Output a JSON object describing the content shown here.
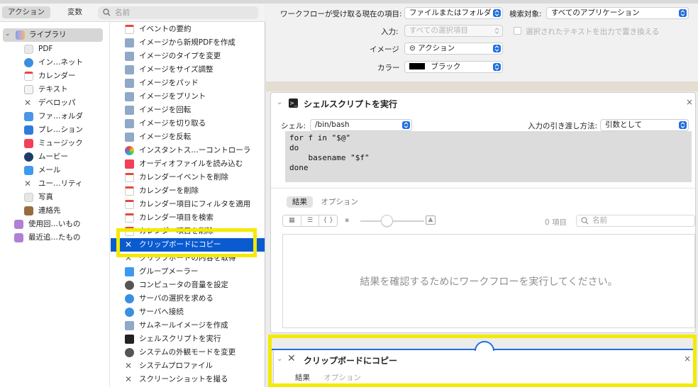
{
  "toolbar": {
    "actions_tab": "アクション",
    "variables_tab": "変数",
    "search_placeholder": "名前"
  },
  "library": {
    "root": "ライブラリ",
    "items": [
      "PDF",
      "イン…ネット",
      "カレンダー",
      "テキスト",
      "デベロッパ",
      "ファ…ォルダ",
      "プレ…ション",
      "ミュージック",
      "ムービー",
      "メール",
      "ユー…リティ",
      "写真",
      "連絡先"
    ],
    "smart": [
      "使用回…いもの",
      "最近追…たもの"
    ]
  },
  "actions": [
    "イベントの要約",
    "イメージから新規PDFを作成",
    "イメージのタイプを変更",
    "イメージをサイズ調整",
    "イメージをパッド",
    "イメージをプリント",
    "イメージを回転",
    "イメージを切り取る",
    "イメージを反転",
    "インスタントス…ーコントローラ",
    "オーディオファイルを読み込む",
    "カレンダーイベントを削除",
    "カレンダーを削除",
    "カレンダー項目にフィルタを適用",
    "カレンダー項目を検索",
    "カレンダー項目を削除",
    "クリップボードにコピー",
    "クリップボードの内容を取得",
    "グループメーラー",
    "コンピュータの音量を設定",
    "サーバの選択を求める",
    "サーバへ接続",
    "サムネールイメージを作成",
    "シェルスクリプトを実行",
    "システムの外観モードを変更",
    "システムプロファイル",
    "スクリーンショットを撮る"
  ],
  "selected_action": "クリップボードにコピー",
  "workflow": {
    "receives_label": "ワークフローが受け取る現在の項目:",
    "receives_value": "ファイルまたはフォルダ",
    "in_label": "検索対象:",
    "in_value": "すべてのアプリケーション",
    "input_label": "入力:",
    "input_value": "すべての選択項目",
    "replace_text": "選択されたテキストを出力で置き換える",
    "image_label": "イメージ",
    "image_value": "⊝ アクション",
    "color_label": "カラー",
    "color_value": "ブラック"
  },
  "shell_card": {
    "title": "シェルスクリプトを実行",
    "shell_label": "シェル:",
    "shell_value": "/bin/bash",
    "pass_label": "入力の引き渡し方法:",
    "pass_value": "引数として",
    "code": "for f in \"$@\"\ndo\n    basename \"$f\"\ndone",
    "tab_results": "結果",
    "tab_options": "オプション",
    "count": "0 項目",
    "search_placeholder": "名前",
    "empty_message": "結果を確認するためにワークフローを実行してください。"
  },
  "clip_card": {
    "title": "クリップボードにコピー",
    "tab_results": "結果",
    "tab_options": "オプション"
  },
  "colors": {
    "selection": "#0a5bd0",
    "highlight": "#f4ea00",
    "accent": "#1f6fe0"
  }
}
